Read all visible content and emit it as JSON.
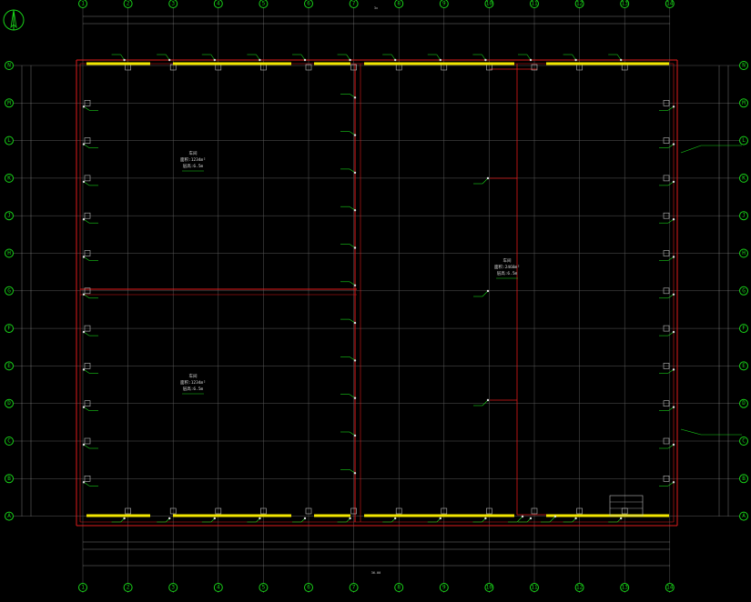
{
  "drawing": {
    "colors": {
      "background": "#000000",
      "grid": "#5a5a5a",
      "wall": "#e01b1b",
      "window": "#f2e600",
      "annotation": "#19d219",
      "text": "#d0d0d0",
      "equipment": "#bdbdbd"
    },
    "compass": {
      "label": "N"
    },
    "axis_columns": [
      "1",
      "2",
      "3",
      "4",
      "5",
      "6",
      "7",
      "8",
      "9",
      "10",
      "11",
      "12",
      "13",
      "14"
    ],
    "axis_rows": [
      "N",
      "M",
      "L",
      "K",
      "J",
      "H",
      "G",
      "F",
      "E",
      "D",
      "C",
      "B",
      "A"
    ],
    "rooms": [
      {
        "id": "room-top-left",
        "lines": [
          "车间",
          "面积:1234m²",
          "层高:6.5m"
        ]
      },
      {
        "id": "room-bottom-left",
        "lines": [
          "车间",
          "面积:1234m²",
          "层高:6.5m"
        ]
      },
      {
        "id": "room-right",
        "lines": [
          "车间",
          "面积:2468m²",
          "层高:6.5m"
        ]
      }
    ],
    "top_dim_total": "3x",
    "bottom_dim_total": "36.00"
  }
}
